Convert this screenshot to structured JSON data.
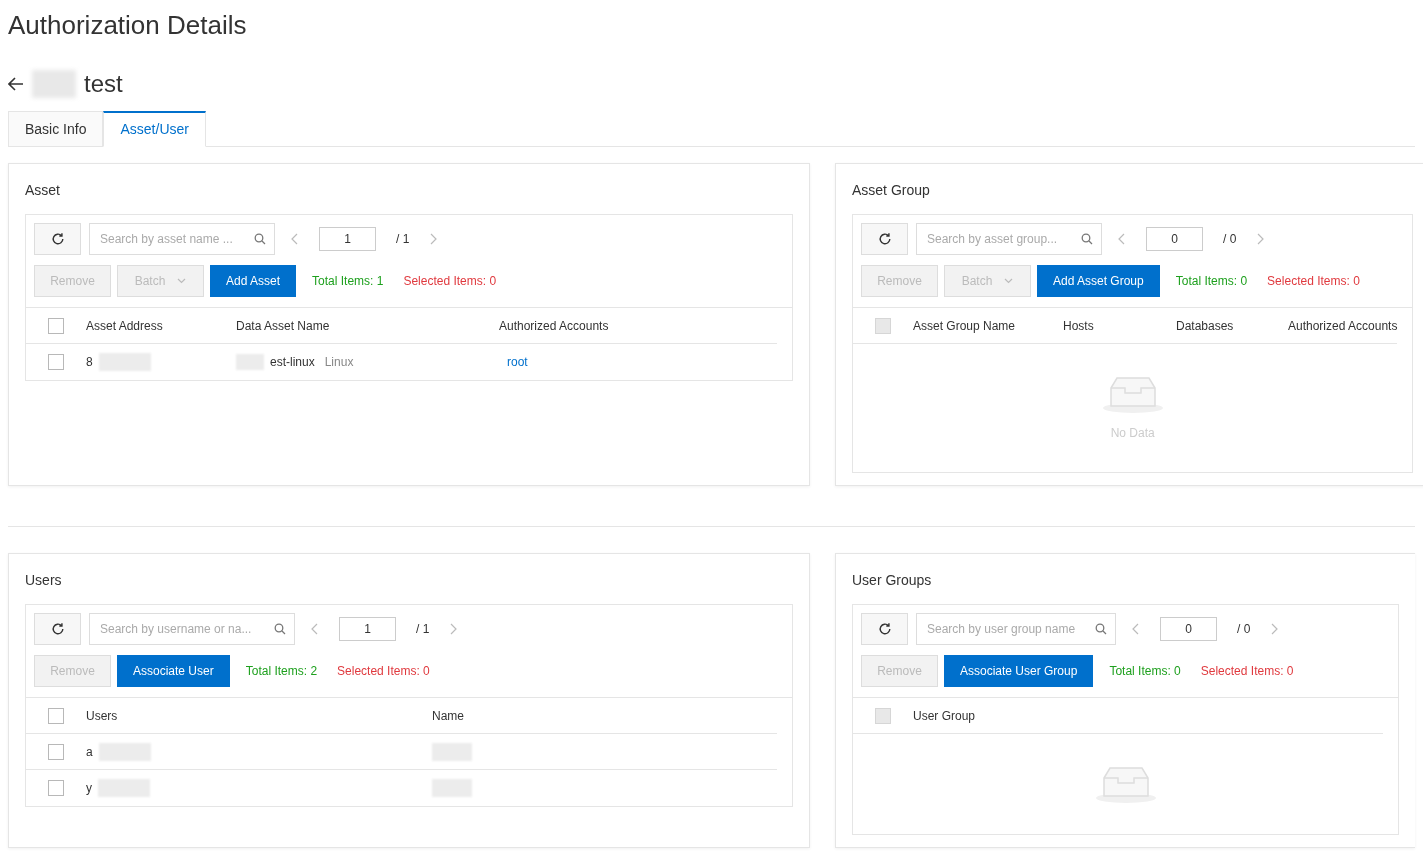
{
  "page_title": "Authorization Details",
  "header": {
    "title": "test"
  },
  "tabs": [
    {
      "label": "Basic Info",
      "selected": false
    },
    {
      "label": "Asset/User",
      "selected": true
    }
  ],
  "panels": [
    {
      "title": "Asset",
      "search": {
        "placeholder": "Search by asset name ..."
      },
      "page": "1",
      "total_pages": "/ 1",
      "buttons": [
        {
          "label": "Remove",
          "kind": "disabled"
        },
        {
          "label": "Batch",
          "kind": "dropdown"
        },
        {
          "label": "Add Asset",
          "kind": "primary"
        }
      ],
      "total_items": "Total Items: 1",
      "selected_items": "Selected Items: 0",
      "columns": [
        "Asset Address",
        "Data Asset Name",
        "Authorized Accounts"
      ],
      "header_checkbox": {
        "checked": false,
        "disabled": false
      },
      "rows": [
        {
          "checked": false,
          "cells": [
            {
              "kind": "masked",
              "text": "8"
            },
            {
              "kind": "masked",
              "text": "est-linux",
              "tag": "Linux"
            },
            {
              "kind": "link",
              "text": "root"
            }
          ]
        }
      ]
    },
    {
      "title": "Asset Group",
      "search": {
        "placeholder": "Search by asset group..."
      },
      "page": "0",
      "total_pages": "/ 0",
      "buttons": [
        {
          "label": "Remove",
          "kind": "disabled"
        },
        {
          "label": "Batch",
          "kind": "dropdown"
        },
        {
          "label": "Add Asset Group",
          "kind": "primary"
        }
      ],
      "total_items": "Total Items: 0",
      "selected_items": "Selected Items: 0",
      "columns": [
        "Asset Group Name",
        "Hosts",
        "Databases",
        "Authorized Accounts"
      ],
      "header_checkbox": {
        "checked": false,
        "disabled": true
      },
      "empty_text": "No Data"
    },
    {
      "title": "Users",
      "search": {
        "placeholder": "Search by username or na..."
      },
      "page": "1",
      "total_pages": "/ 1",
      "buttons": [
        {
          "label": "Remove",
          "kind": "disabled"
        },
        {
          "label": "Associate User",
          "kind": "primary"
        }
      ],
      "total_items": "Total Items: 2",
      "selected_items": "Selected Items: 0",
      "columns": [
        "Users",
        "Name"
      ],
      "header_checkbox": {
        "checked": false,
        "disabled": false
      },
      "rows": [
        {
          "checked": false,
          "cells": [
            {
              "kind": "masked",
              "text": "a"
            },
            {
              "kind": "masked"
            }
          ]
        },
        {
          "checked": false,
          "cells": [
            {
              "kind": "masked",
              "text": "y"
            },
            {
              "kind": "masked"
            }
          ]
        }
      ]
    },
    {
      "title": "User Groups",
      "search": {
        "placeholder": "Search by user group name"
      },
      "page": "0",
      "total_pages": "/ 0",
      "buttons": [
        {
          "label": "Remove",
          "kind": "disabled"
        },
        {
          "label": "Associate User Group",
          "kind": "primary"
        }
      ],
      "total_items": "Total Items: 0",
      "selected_items": "Selected Items: 0",
      "columns": [
        "User Group"
      ],
      "header_checkbox": {
        "checked": false,
        "disabled": true
      }
    }
  ]
}
